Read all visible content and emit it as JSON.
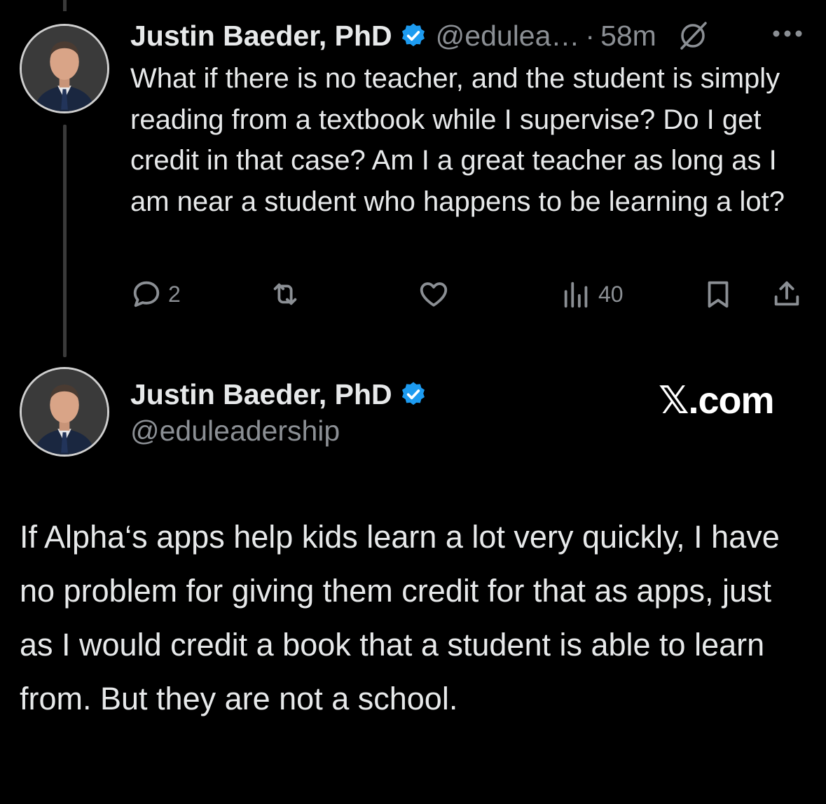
{
  "tweet": {
    "author_name": "Justin Baeder, PhD",
    "handle": "@edulea…",
    "separator": "·",
    "time": "58m",
    "text": "What if there is no teacher, and the student is simply reading from a textbook while I supervise? Do I get credit in that case? Am I a great teacher as long as I am near a student who happens to be learning a lot?",
    "actions": {
      "replies": "2",
      "reposts": "",
      "likes": "",
      "views": "40"
    }
  },
  "card": {
    "author_name": "Justin Baeder, PhD",
    "handle": "@eduleadership",
    "brand": "𝕏.com",
    "text": "If Alpha‘s apps help kids learn a lot very quickly, I have no problem for giving them credit for that as apps, just as I would credit a book that a student is able to learn from. But they are not a school."
  },
  "colors": {
    "background": "#000000",
    "text": "#e7e9ea",
    "muted": "#8b8f94",
    "verified": "#1d9bf0"
  },
  "icons": [
    "avatar-photo",
    "verified-badge-icon",
    "grok-icon",
    "more-icon",
    "reply-icon",
    "repost-icon",
    "like-icon",
    "views-icon",
    "bookmark-icon",
    "share-icon"
  ]
}
